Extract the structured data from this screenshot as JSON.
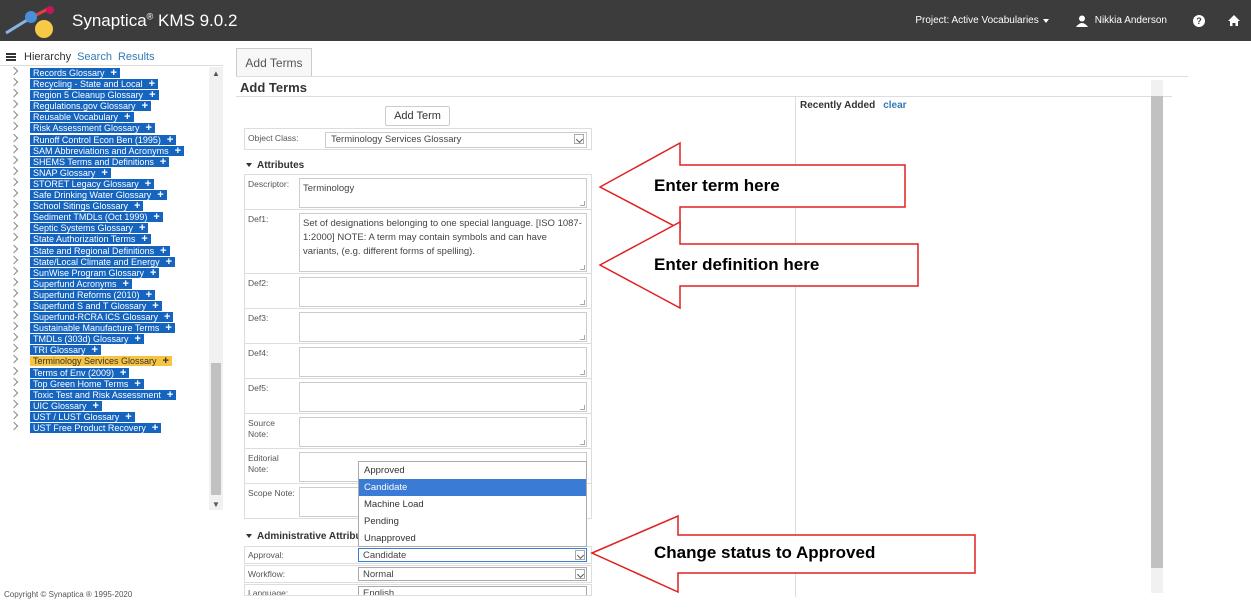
{
  "app": {
    "brand": "Synaptica",
    "reg": "®",
    "version": " KMS 9.0.2",
    "project": "Project: Active Vocabularies",
    "user": "Nikkia Anderson",
    "copyright": "Copyright © Synaptica ® 1995-2020"
  },
  "left": {
    "tabs": [
      "Hierarchy",
      "Search",
      "Results"
    ],
    "items": [
      "Records Glossary",
      "Recycling - State and Local",
      "Region 5 Cleanup Glossary",
      "Regulations.gov Glossary",
      "Reusable Vocabulary",
      "Risk Assessment Glossary",
      "Runoff Control Econ Ben (1995)",
      "SAM Abbreviations and Acronyms",
      "SHEMS Terms and Definitions",
      "SNAP Glossary",
      "STORET Legacy Glossary",
      "Safe Drinking Water Glossary",
      "School Sitings Glossary",
      "Sediment TMDLs (Oct 1999)",
      "Septic Systems Glossary",
      "State Authorization Terms",
      "State and Regional Definitions",
      "State/Local Climate and Energy",
      "SunWise Program Glossary",
      "Superfund Acronyms",
      "Superfund Reforms (2010)",
      "Superfund S and T Glossary",
      "Superfund-RCRA ICS Glossary",
      "Sustainable Manufacture Terms",
      "TMDLs (303d) Glossary",
      "TRI Glossary",
      "Terminology Services Glossary",
      "Terms of Env (2009)",
      "Top Green Home Terms",
      "Toxic Test and Risk Assessment",
      "UIC Glossary",
      "UST / LUST Glossary",
      "UST Free Product Recovery"
    ],
    "selected_index": 26
  },
  "main": {
    "tab": "Add Terms",
    "title": "Add Terms",
    "add_button": "Add Term",
    "recently_added": "Recently Added",
    "clear": "clear",
    "object_class_label": "Object Class:",
    "object_class_value": "Terminology Services Glossary",
    "attributes_title": "Attributes",
    "fields": [
      {
        "label": "Descriptor:",
        "value": "Terminology"
      },
      {
        "label": "Def1:",
        "value": "Set of designations belonging to one special language. [ISO 1087-1:2000] NOTE: A term may contain symbols and can have variants, (e.g. different forms of spelling)."
      },
      {
        "label": "Def2:",
        "value": ""
      },
      {
        "label": "Def3:",
        "value": ""
      },
      {
        "label": "Def4:",
        "value": ""
      },
      {
        "label": "Def5:",
        "value": ""
      },
      {
        "label": "Source Note:",
        "value": ""
      },
      {
        "label": "Editorial Note:",
        "value": ""
      },
      {
        "label": "Scope Note:",
        "value": ""
      }
    ],
    "admin_title": "Administrative Attribu",
    "approval_label": "Approval:",
    "approval_value": "Candidate",
    "workflow_label": "Workflow:",
    "workflow_value": "Normal",
    "language_label": "Language:",
    "language_value": "English",
    "approval_options": [
      "Approved",
      "Candidate",
      "Machine Load",
      "Pending",
      "Unapproved"
    ],
    "approval_highlighted": 1
  },
  "callouts": {
    "term": "Enter term here",
    "definition": "Enter definition here",
    "status": "Change status to Approved",
    "color": "#e02020"
  }
}
